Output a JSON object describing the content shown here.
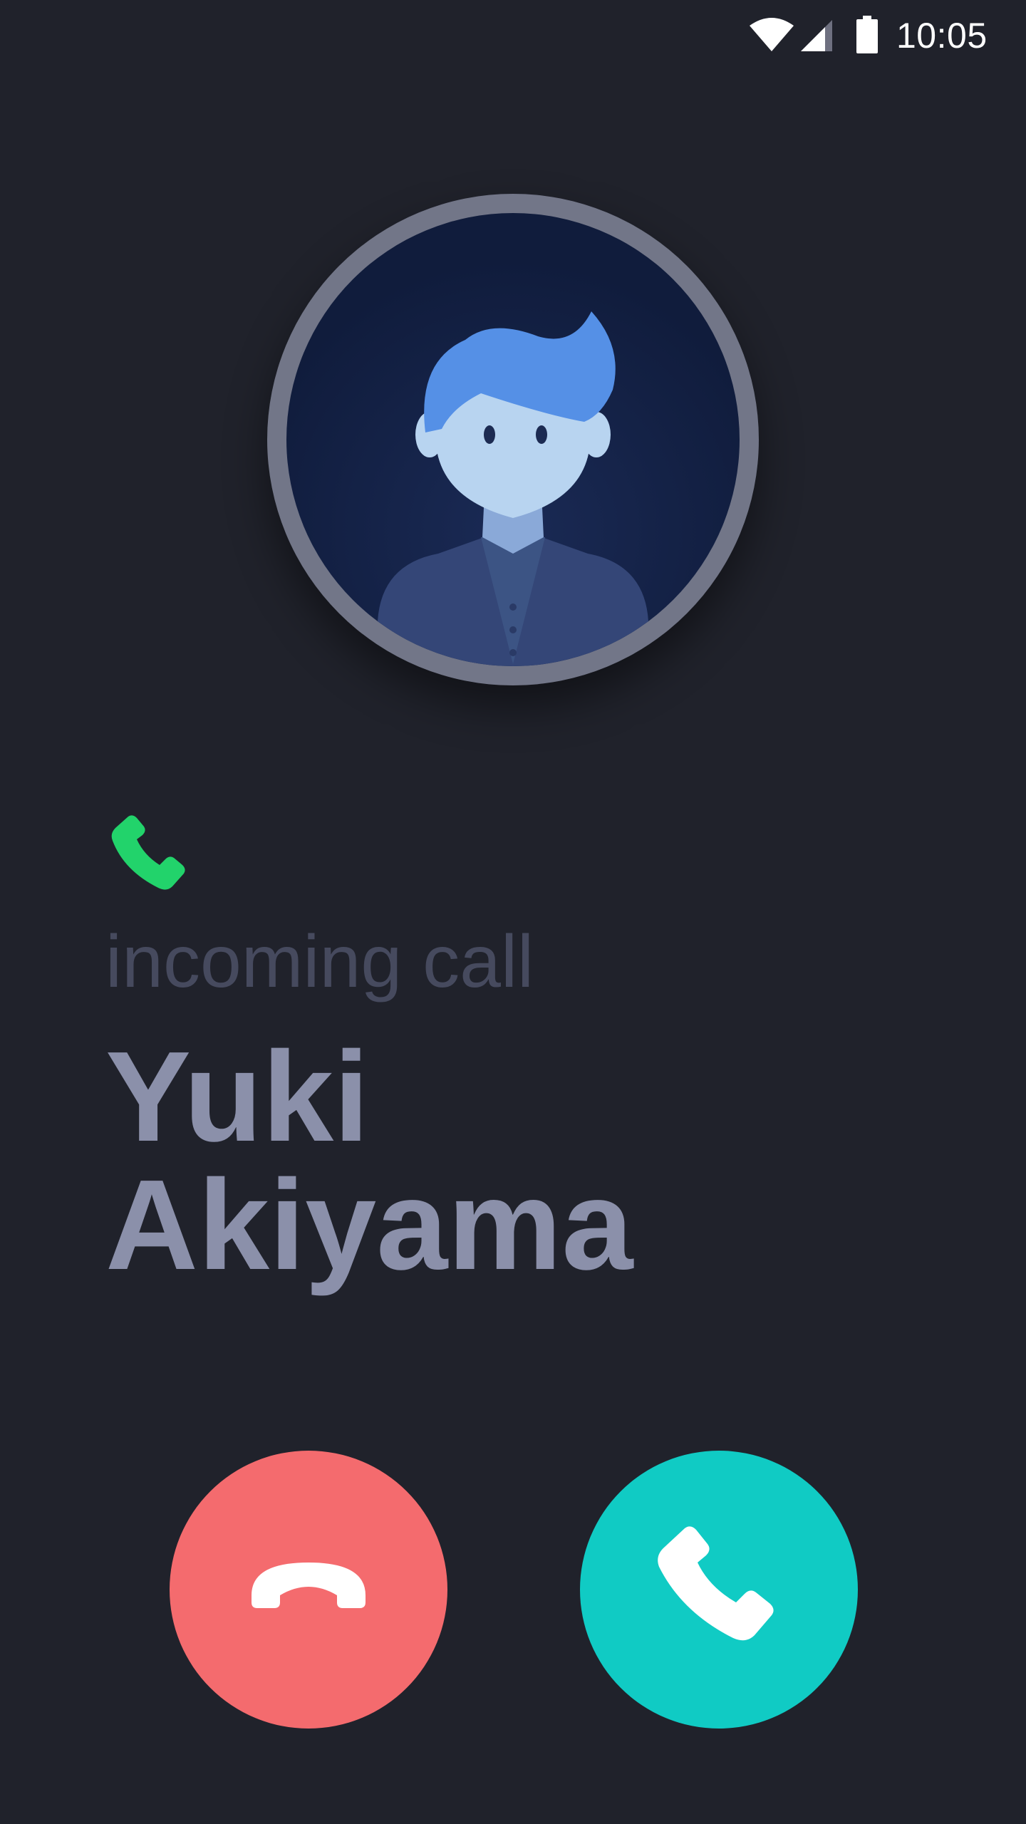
{
  "status_bar": {
    "time": "10:05",
    "wifi_icon": "wifi-icon",
    "signal_icon": "cellular-signal-icon",
    "battery_icon": "battery-icon"
  },
  "avatar": {
    "icon": "person-avatar-illustration"
  },
  "call": {
    "indicator_icon": "phone-icon",
    "label": "incoming call",
    "caller_first_name": "Yuki",
    "caller_last_name": "Akiyama"
  },
  "actions": {
    "decline_icon": "hang-up-icon",
    "accept_icon": "phone-icon"
  },
  "colors": {
    "background": "#20222b",
    "decline": "#f46b6e",
    "accept": "#10cbc4",
    "indicator_green": "#22d36b",
    "name_text": "#8b90aa",
    "label_text": "#464a5e"
  }
}
